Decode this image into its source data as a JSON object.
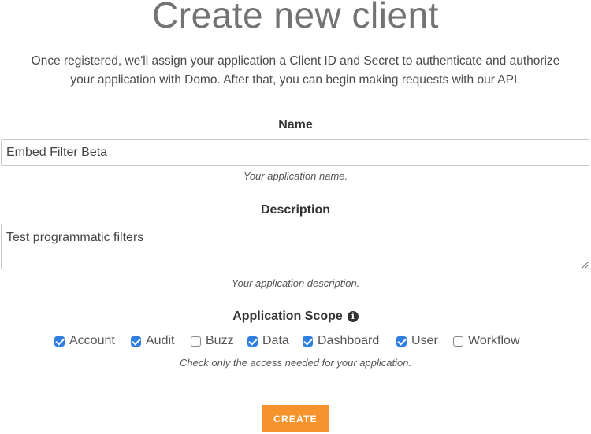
{
  "page": {
    "title": "Create new client",
    "intro_line1": "Once registered, we'll assign your application a Client ID and Secret to authenticate and authorize",
    "intro_line2": "your application with Domo. After that, you can begin making requests with our API."
  },
  "form": {
    "name": {
      "label": "Name",
      "value": "Embed Filter Beta",
      "hint": "Your application name."
    },
    "description": {
      "label": "Description",
      "value": "Test programmatic filters",
      "hint": "Your application description."
    },
    "scope": {
      "label": "Application Scope",
      "info_icon": "info-circle-icon",
      "hint": "Check only the access needed for your application.",
      "options": [
        {
          "label": "Account",
          "checked": true
        },
        {
          "label": "Audit",
          "checked": true
        },
        {
          "label": "Buzz",
          "checked": false
        },
        {
          "label": "Data",
          "checked": true
        },
        {
          "label": "Dashboard",
          "checked": true
        },
        {
          "label": "User",
          "checked": true
        },
        {
          "label": "Workflow",
          "checked": false
        }
      ]
    },
    "create_label": "CREATE"
  },
  "colors": {
    "accent_button": "#f7932d",
    "checkbox_checked": "#2f7fe0"
  }
}
